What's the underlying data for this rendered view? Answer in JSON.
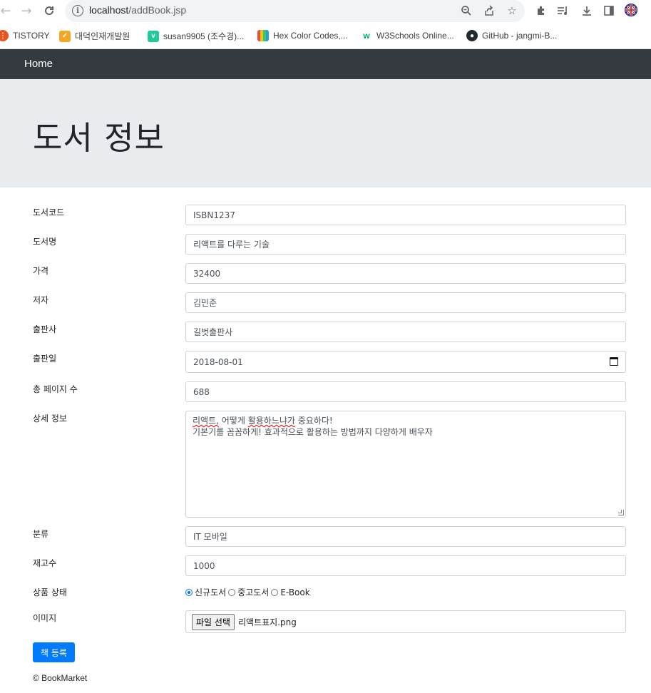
{
  "browser": {
    "url_host": "localhost",
    "url_path": "/addBook.jsp",
    "bookmarks": [
      {
        "label": "TISTORY",
        "icon": "tistory-icon",
        "color": "#eb531f"
      },
      {
        "label": "대덕인재개발원",
        "icon": "ddit-icon",
        "color": "#f5a623"
      },
      {
        "label": "susan9905 (조수경)...",
        "icon": "velog-icon",
        "color": "#20c997"
      },
      {
        "label": "Hex Color Codes,...",
        "icon": "hexcolor-icon",
        "color": "#e74c3c"
      },
      {
        "label": "W3Schools Online...",
        "icon": "w3schools-icon",
        "color": "#04aa6d"
      },
      {
        "label": "GitHub - jangmi-B...",
        "icon": "github-icon",
        "color": "#24292e"
      }
    ]
  },
  "navbar": {
    "brand": "Home"
  },
  "jumbotron": {
    "title": "도서 정보"
  },
  "form": {
    "book_id": {
      "label": "도서코드",
      "value": "ISBN1237"
    },
    "name": {
      "label": "도서명",
      "value": "리액트를 다루는 기술"
    },
    "price": {
      "label": "가격",
      "value": "32400"
    },
    "author": {
      "label": "저자",
      "value": "김민준"
    },
    "publisher": {
      "label": "출판사",
      "value": "길벗출판사"
    },
    "release_date": {
      "label": "출판일",
      "value": "2018-08-01"
    },
    "total_pages": {
      "label": "총 페이지 수",
      "value": "688"
    },
    "description": {
      "label": "상세 정보",
      "line1_a": "리액트,",
      "line1_b": " 어떻게 ",
      "line1_c": "활용하느냐가",
      "line1_d": " 중요하다!",
      "line2": "기본기를 꼼꼼하게! 효과적으로 활용하는 방법까지 다양하게 배우자"
    },
    "category": {
      "label": "분류",
      "value": "IT 모바일"
    },
    "units_in_stock": {
      "label": "재고수",
      "value": "1000"
    },
    "condition": {
      "label": "상품 상태",
      "options": [
        "신규도서",
        "중고도서",
        "E-Book"
      ],
      "selected": "신규도서"
    },
    "image": {
      "label": "이미지",
      "button": "파일 선택",
      "filename": "리액트표지.png"
    },
    "submit": "책 등록"
  },
  "footer": "© BookMarket"
}
